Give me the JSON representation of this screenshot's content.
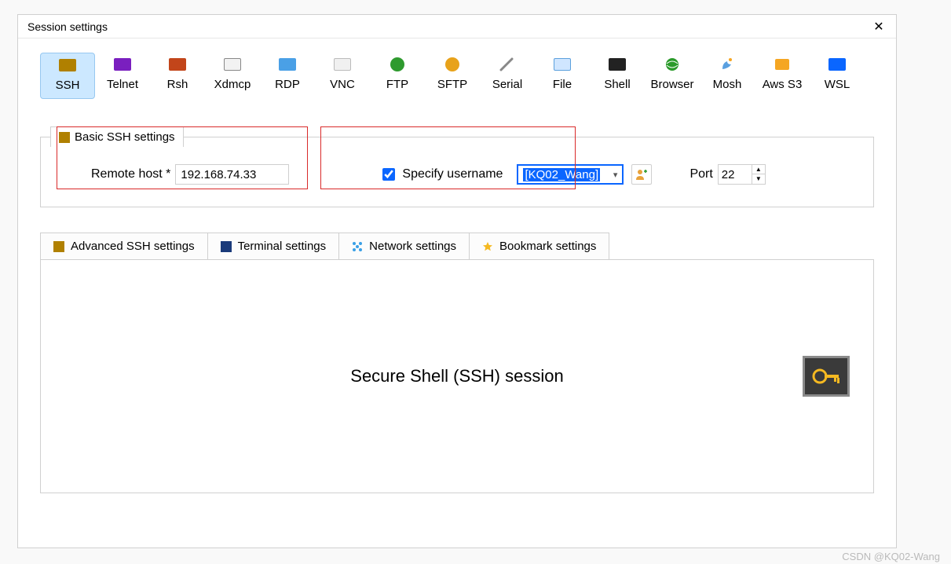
{
  "window": {
    "title": "Session settings"
  },
  "protocols": {
    "ssh": "SSH",
    "telnet": "Telnet",
    "rsh": "Rsh",
    "xdmcp": "Xdmcp",
    "rdp": "RDP",
    "vnc": "VNC",
    "ftp": "FTP",
    "sftp": "SFTP",
    "serial": "Serial",
    "file": "File",
    "shell": "Shell",
    "browser": "Browser",
    "mosh": "Mosh",
    "aws": "Aws S3",
    "wsl": "WSL"
  },
  "basic": {
    "legend": "Basic SSH settings",
    "remote_host_label": "Remote host *",
    "remote_host_value": "192.168.74.33",
    "specify_username_label": "Specify username",
    "specify_username_checked": true,
    "username_value": "[KQ02_Wang]",
    "port_label": "Port",
    "port_value": "22"
  },
  "tabs": {
    "advanced": "Advanced SSH settings",
    "terminal": "Terminal settings",
    "network": "Network settings",
    "bookmark": "Bookmark settings"
  },
  "panel": {
    "title": "Secure Shell (SSH) session"
  },
  "watermark": "CSDN @KQ02-Wang"
}
